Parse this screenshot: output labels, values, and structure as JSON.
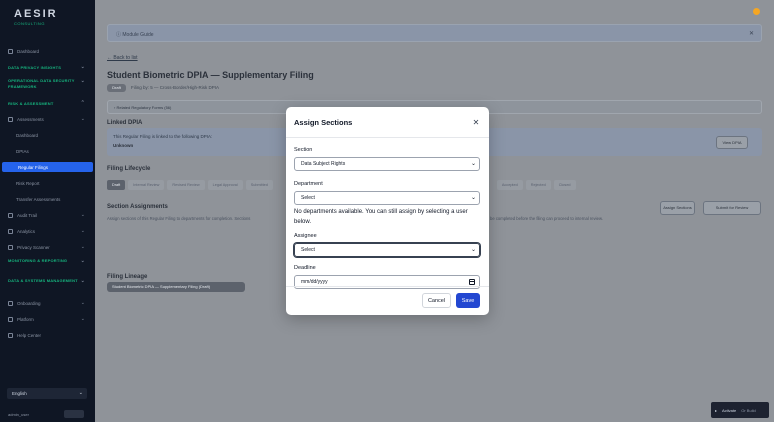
{
  "app": {
    "logo_word": "AESIR",
    "logo_sub": "CONSULTING"
  },
  "sidebar": {
    "items": [
      {
        "label": "Dashboard"
      },
      {
        "label": "DATA PRIVACY INSIGHTS"
      },
      {
        "label": "OPERATIONAL DATA SECURITY FRAMEWORK"
      },
      {
        "label": "RISK & ASSESSMENT"
      },
      {
        "label": "Assessments"
      },
      {
        "label": "Dashboard"
      },
      {
        "label": "DPIAs"
      },
      {
        "label": "Regular Filings"
      },
      {
        "label": "Risk Report"
      },
      {
        "label": "Transfer Assessments"
      },
      {
        "label": "Audit Trail"
      },
      {
        "label": "Analytics"
      },
      {
        "label": "Privacy Scanner"
      },
      {
        "label": "MONITORING & REPORTING"
      },
      {
        "label": "DATA & SYSTEMS MANAGEMENT"
      },
      {
        "label": "Onboarding"
      },
      {
        "label": "Platform"
      },
      {
        "label": "Help Center"
      }
    ],
    "language": "English",
    "user": "admin_user",
    "logout_label": "Logout"
  },
  "guide": {
    "label": "Module Guide"
  },
  "page": {
    "back_link": "← Back to list",
    "title": "Student Biometric DPIA — Supplementary Filing",
    "status_badge": "Draft",
    "meta": "Filing by: 5 — Cross-Border/High-Risk DPIA",
    "regulation": "Related Regulatory Forms (56)"
  },
  "linked_dpia": {
    "heading": "Linked DPIA",
    "text": "This Regular Filing is linked to the following DPIA:",
    "value": "Unknown",
    "view_button": "View DPIA"
  },
  "lifecycle": {
    "heading": "Filing Lifecycle",
    "stages": [
      "Draft",
      "Internal Review",
      "Revised Review",
      "Legal Approval",
      "Submitted",
      "",
      "",
      "",
      "",
      "",
      "",
      "",
      "Accepted",
      "Rejected",
      "Closed"
    ]
  },
  "section_assignments": {
    "heading": "Section Assignments",
    "desc_left": "Assign sections of this Regular Filing to departments for completion. Sections",
    "desc_right": "be completed before the filing can proceed to internal review.",
    "assign_button": "Assign Sections",
    "submit_button": "Submit for Review"
  },
  "lineage": {
    "heading": "Filing Lineage",
    "chip": "Student Biometric DPIA — Supplementary Filing (Draft)"
  },
  "activate_widget": {
    "activate": "Activate",
    "dismiss": "Or Build"
  },
  "modal": {
    "title": "Assign Sections",
    "section_label": "Section",
    "section_value": "Data Subject Rights",
    "department_label": "Department",
    "department_value": "Select",
    "department_help": "No departments available. You can still assign by selecting a user below.",
    "assignee_label": "Assignee",
    "assignee_value": "Select",
    "deadline_label": "Deadline",
    "deadline_placeholder": "mm/dd/yyyy",
    "cancel_label": "Cancel",
    "save_label": "Save"
  },
  "colors": {
    "sidebar_bg": "#0f1624",
    "accent": "#2563eb",
    "save_button": "#2347d1",
    "brand_green": "#16b57f"
  }
}
